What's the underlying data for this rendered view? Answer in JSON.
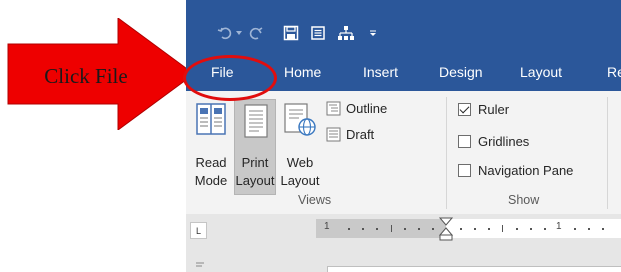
{
  "annotation": {
    "label": "Click File",
    "arrow_color": "#ee0000",
    "circle_color": "#e10d0d"
  },
  "titlebar": {
    "color": "#2b579a",
    "quick_access": [
      {
        "icon": "undo-icon"
      },
      {
        "icon": "redo-icon"
      },
      {
        "icon": "save-icon"
      },
      {
        "icon": "document-icon"
      },
      {
        "icon": "sitemap-icon"
      },
      {
        "icon": "customize-qat-icon"
      }
    ]
  },
  "tabs": [
    {
      "label": "File"
    },
    {
      "label": "Home"
    },
    {
      "label": "Insert"
    },
    {
      "label": "Design"
    },
    {
      "label": "Layout"
    },
    {
      "label": "Re"
    }
  ],
  "ribbon": {
    "views_group": {
      "label": "Views",
      "read_mode": {
        "line1": "Read",
        "line2": "Mode"
      },
      "print_layout": {
        "line1": "Print",
        "line2": "Layout"
      },
      "web_layout": {
        "line1": "Web",
        "line2": "Layout"
      },
      "outline": "Outline",
      "draft": "Draft"
    },
    "show_group": {
      "label": "Show",
      "ruler": {
        "label": "Ruler",
        "checked": true
      },
      "gridlines": {
        "label": "Gridlines",
        "checked": false
      },
      "navigation_pane": {
        "label": "Navigation Pane",
        "checked": false
      }
    }
  },
  "ruler": {
    "tab_selector": "L",
    "numbers": [
      "1",
      "1"
    ]
  }
}
